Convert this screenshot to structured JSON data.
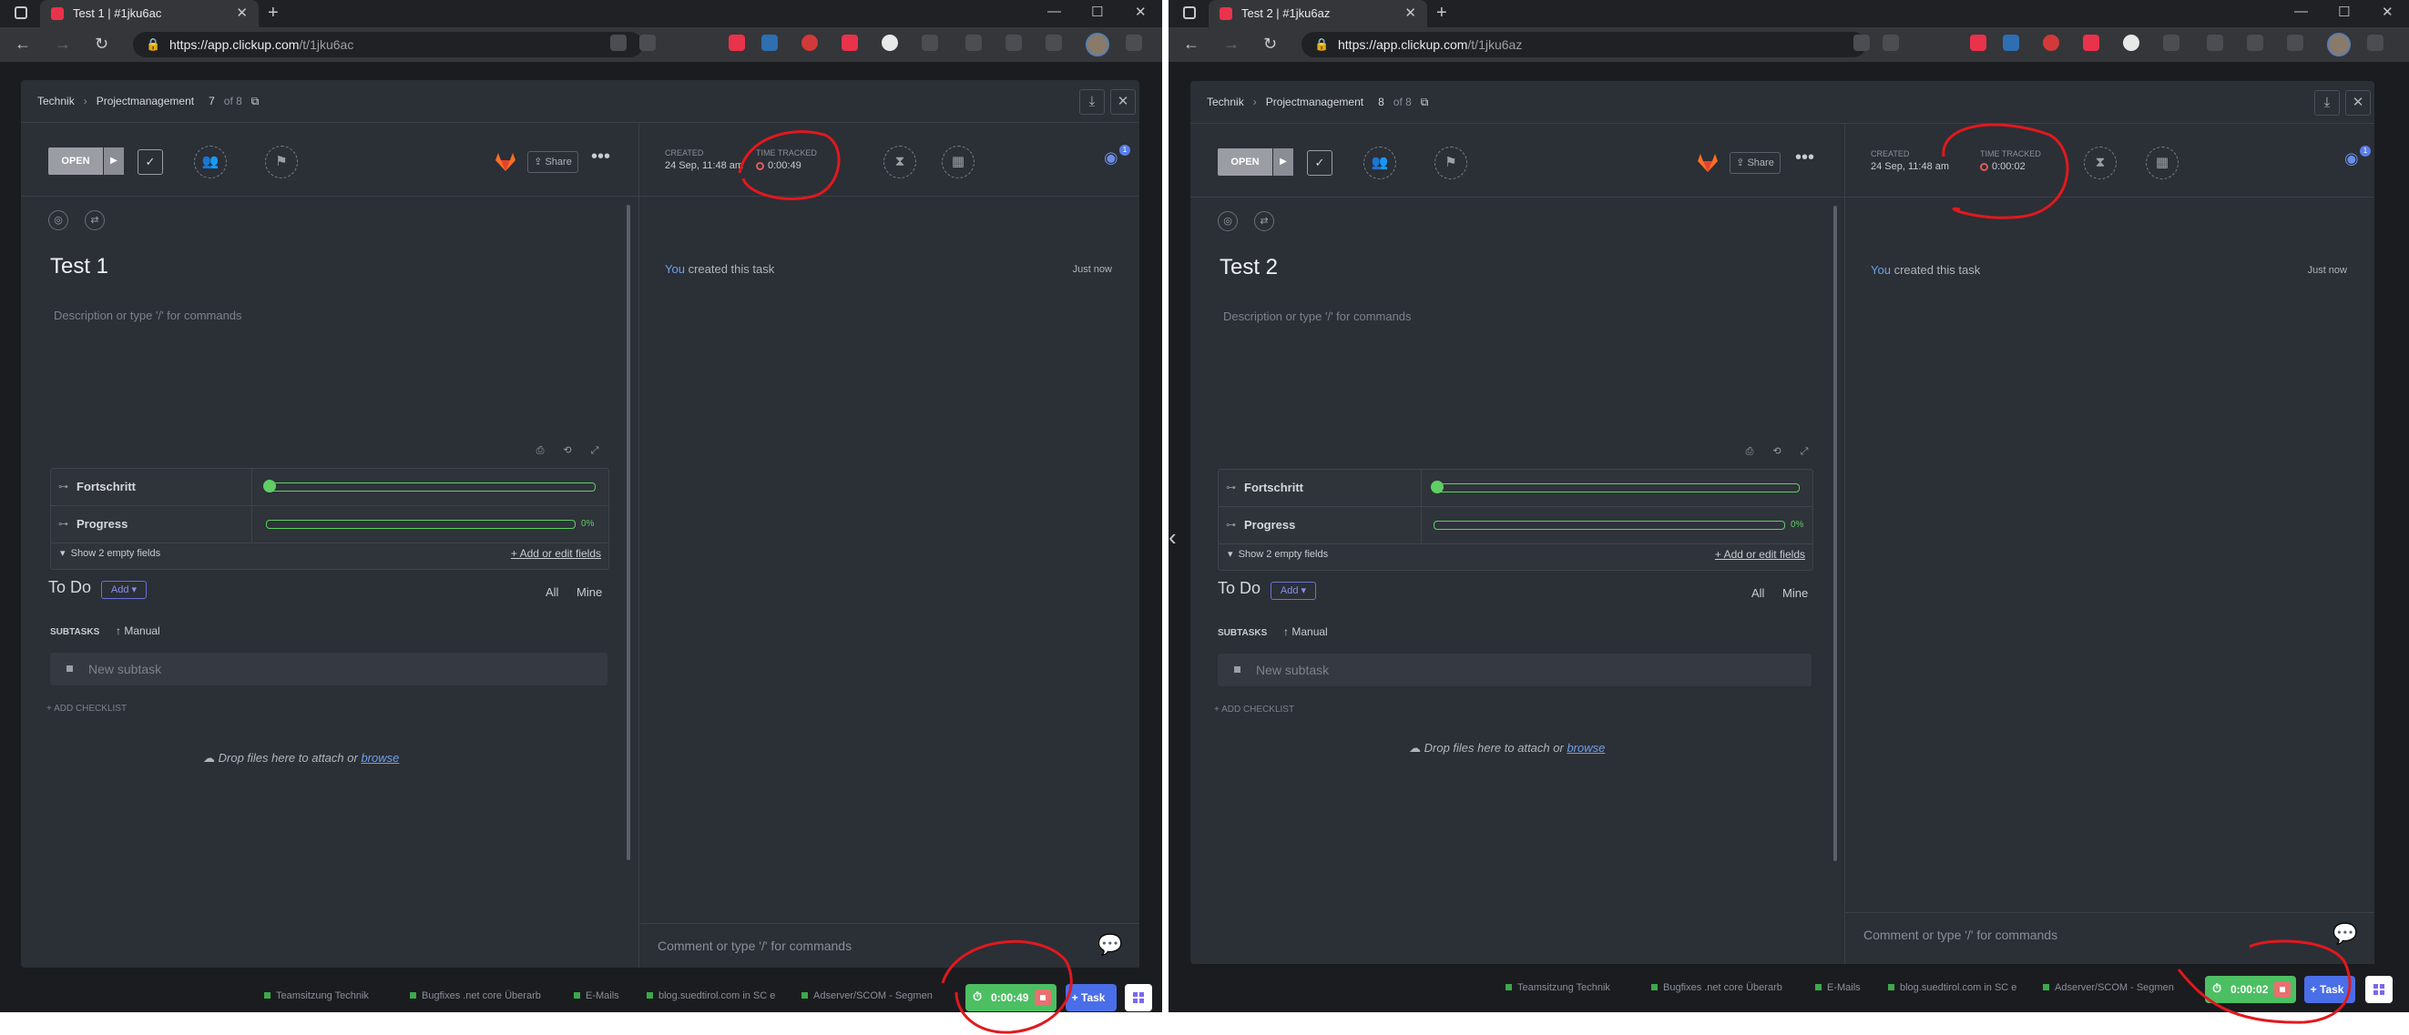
{
  "windows": [
    {
      "tab_title": "Test 1 | #1jku6ac",
      "url_host": "https://app.clickup.com",
      "url_path": "/t/1jku6ac",
      "breadcrumb": {
        "space": "Technik",
        "folder": "Projectmanagement",
        "position": "7",
        "of": "of 8"
      },
      "status": "OPEN",
      "share_label": "Share",
      "created_label": "CREATED",
      "created_value": "24 Sep, 11:48 am",
      "time_tracked_label": "TIME TRACKED",
      "time_tracked_value": "0:00:49",
      "watchers": "1",
      "task_title": "Test 1",
      "description_placeholder": "Description or type '/' for commands",
      "fields": [
        {
          "name": "Fortschritt",
          "percent": 0
        },
        {
          "name": "Progress",
          "percent": 0,
          "pct_label": "0%"
        }
      ],
      "show_empty": "Show 2 empty fields",
      "add_edit_fields": "+ Add or edit fields",
      "todo_label": "To Do",
      "add_label": "Add",
      "filter_all": "All",
      "filter_mine": "Mine",
      "subtasks_label": "SUBTASKS",
      "manual_label": "Manual",
      "new_subtask_placeholder": "New subtask",
      "add_checklist": "+ ADD CHECKLIST",
      "drop_text": "Drop files here to attach or",
      "browse": "browse",
      "activity_you": "You",
      "activity_text": "created this task",
      "activity_time": "Just now",
      "comment_placeholder": "Comment or type '/' for commands",
      "timer_value": "0:00:49",
      "task_button": "Task",
      "taskbar_items": [
        "Teamsitzung Technik",
        "Bugfixes .net core Überarb",
        "E-Mails",
        "blog.suedtirol.com in SC e",
        "Adserver/SCOM - Segmen"
      ]
    },
    {
      "tab_title": "Test 2 | #1jku6az",
      "url_host": "https://app.clickup.com",
      "url_path": "/t/1jku6az",
      "breadcrumb": {
        "space": "Technik",
        "folder": "Projectmanagement",
        "position": "8",
        "of": "of 8"
      },
      "status": "OPEN",
      "share_label": "Share",
      "created_label": "CREATED",
      "created_value": "24 Sep, 11:48 am",
      "time_tracked_label": "TIME TRACKED",
      "time_tracked_value": "0:00:02",
      "watchers": "1",
      "task_title": "Test 2",
      "description_placeholder": "Description or type '/' for commands",
      "fields": [
        {
          "name": "Fortschritt",
          "percent": 0
        },
        {
          "name": "Progress",
          "percent": 0,
          "pct_label": "0%"
        }
      ],
      "show_empty": "Show 2 empty fields",
      "add_edit_fields": "+ Add or edit fields",
      "todo_label": "To Do",
      "add_label": "Add",
      "filter_all": "All",
      "filter_mine": "Mine",
      "subtasks_label": "SUBTASKS",
      "manual_label": "Manual",
      "new_subtask_placeholder": "New subtask",
      "add_checklist": "+ ADD CHECKLIST",
      "drop_text": "Drop files here to attach or",
      "browse": "browse",
      "activity_you": "You",
      "activity_text": "created this task",
      "activity_time": "Just now",
      "comment_placeholder": "Comment or type '/' for commands",
      "timer_value": "0:00:02",
      "task_button": "Task",
      "taskbar_items": [
        "Teamsitzung Technik",
        "Bugfixes .net core Überarb",
        "E-Mails",
        "blog.suedtirol.com in SC e",
        "Adserver/SCOM - Segmen"
      ]
    }
  ],
  "colors": {
    "accent": "#7b68ee",
    "progress": "#5fcf64",
    "timer": "#4cbf62",
    "annotation": "#e0191e",
    "link": "#6fa0e8"
  }
}
